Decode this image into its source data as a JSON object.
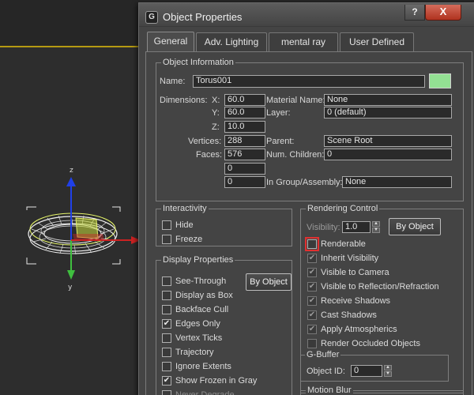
{
  "dialog": {
    "title": "Object Properties",
    "help_label": "?",
    "close_label": "X",
    "app_icon_glyph": "G"
  },
  "tabs": [
    {
      "label": "General",
      "active": true
    },
    {
      "label": "Adv. Lighting",
      "active": false
    },
    {
      "label": "mental ray",
      "active": false
    },
    {
      "label": "User Defined",
      "active": false
    }
  ],
  "object_information": {
    "title": "Object Information",
    "name_label": "Name:",
    "name_value": "Torus001",
    "color": "#93e093",
    "dimensions_label": "Dimensions:",
    "x_label": "X:",
    "x_value": "60.0",
    "y_label": "Y:",
    "y_value": "60.0",
    "z_label": "Z:",
    "z_value": "10.0",
    "material_label": "Material Name:",
    "material_value": "None",
    "layer_label": "Layer:",
    "layer_value": "0 (default)",
    "vertices_label": "Vertices:",
    "vertices_value": "288",
    "faces_label": "Faces:",
    "faces_value": "576",
    "parent_label": "Parent:",
    "parent_value": "Scene Root",
    "num_children_label": "Num. Children:",
    "num_children_value": "0",
    "extra1_value": "0",
    "extra2_value": "0",
    "group_label": "In Group/Assembly:",
    "group_value": "None"
  },
  "interactivity": {
    "title": "Interactivity",
    "items": [
      {
        "label": "Hide",
        "checked": false
      },
      {
        "label": "Freeze",
        "checked": false
      }
    ]
  },
  "display_properties": {
    "title": "Display Properties",
    "by_object_label": "By Object",
    "items": [
      {
        "label": "See-Through",
        "checked": false
      },
      {
        "label": "Display as Box",
        "checked": false
      },
      {
        "label": "Backface Cull",
        "checked": false
      },
      {
        "label": "Edges Only",
        "checked": true
      },
      {
        "label": "Vertex Ticks",
        "checked": false
      },
      {
        "label": "Trajectory",
        "checked": false
      },
      {
        "label": "Ignore Extents",
        "checked": false
      },
      {
        "label": "Show Frozen in Gray",
        "checked": true
      },
      {
        "label": "Never Degrade",
        "checked": false
      }
    ]
  },
  "rendering_control": {
    "title": "Rendering Control",
    "visibility_label": "Visibility:",
    "visibility_value": "1.0",
    "by_object_label": "By Object",
    "items": [
      {
        "label": "Renderable",
        "checked": false,
        "dim": false
      },
      {
        "label": "Inherit Visibility",
        "checked": true,
        "dim": true
      },
      {
        "label": "Visible to Camera",
        "checked": true,
        "dim": true
      },
      {
        "label": "Visible to Reflection/Refraction",
        "checked": true,
        "dim": true
      },
      {
        "label": "Receive Shadows",
        "checked": true,
        "dim": true
      },
      {
        "label": "Cast Shadows",
        "checked": true,
        "dim": true
      },
      {
        "label": "Apply Atmospherics",
        "checked": true,
        "dim": true
      },
      {
        "label": "Render Occluded Objects",
        "checked": false,
        "dim": true
      }
    ]
  },
  "gbuffer": {
    "title": "G-Buffer",
    "object_id_label": "Object ID:",
    "object_id_value": "0"
  },
  "motion_blur": {
    "title": "Motion Blur"
  },
  "viewport": {
    "axis_z": "z",
    "axis_y": "y",
    "background": "#2d2d2d",
    "horizon_color": "#b59a12"
  }
}
